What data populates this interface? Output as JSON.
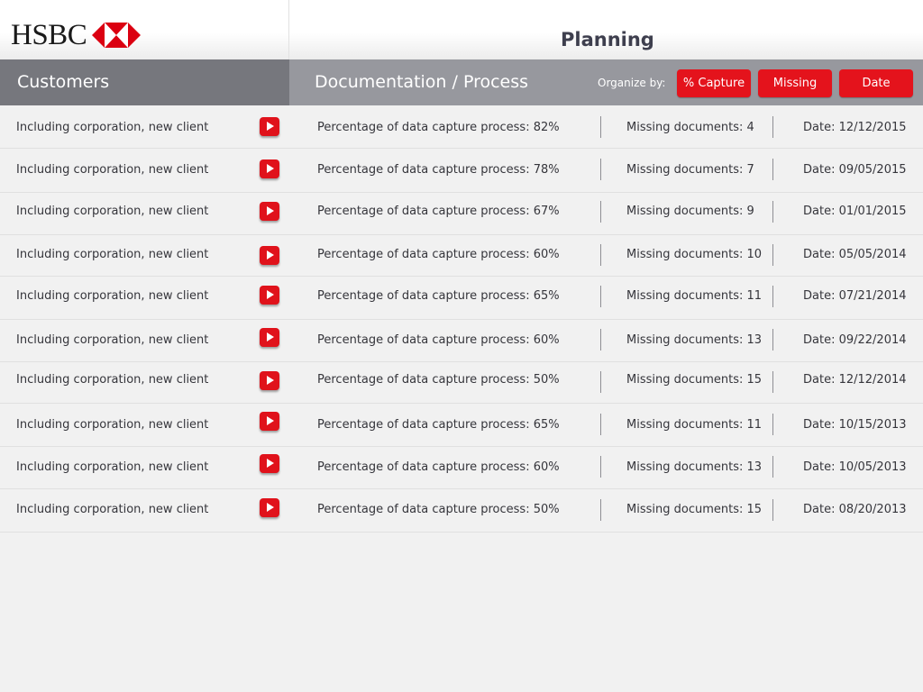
{
  "brand": {
    "name": "HSBC"
  },
  "header": {
    "title": "Planning"
  },
  "columns": {
    "customers": "Customers",
    "documentation": "Documentation / Process"
  },
  "organize": {
    "label": "Organize by:",
    "buttons": [
      "% Capture",
      "Missing",
      "Date"
    ]
  },
  "colors": {
    "accent": "#e4131c",
    "header_dark": "#76777d",
    "header_light": "#97989e"
  },
  "rows": [
    {
      "customer": "Including corporation, new client",
      "percentage": "Percentage of data capture process: 82%",
      "missing": "Missing documents: 4",
      "date": "Date: 12/12/2015"
    },
    {
      "customer": "Including corporation, new client",
      "percentage": "Percentage of data capture process: 78%",
      "missing": "Missing documents: 7",
      "date": "Date: 09/05/2015"
    },
    {
      "customer": "Including corporation, new client",
      "percentage": "Percentage of data capture process: 67%",
      "missing": "Missing documents: 9",
      "date": "Date: 01/01/2015"
    },
    {
      "customer": "Including corporation, new client",
      "percentage": "Percentage of data capture process: 60%",
      "missing": "Missing documents: 10",
      "date": "Date: 05/05/2014"
    },
    {
      "customer": "Including corporation, new client",
      "percentage": "Percentage of data capture process: 65%",
      "missing": "Missing documents: 11",
      "date": "Date: 07/21/2014"
    },
    {
      "customer": "Including corporation, new client",
      "percentage": "Percentage of data capture process: 60%",
      "missing": "Missing documents: 13",
      "date": "Date: 09/22/2014"
    },
    {
      "customer": "Including corporation, new client",
      "percentage": "Percentage of data capture process: 50%",
      "missing": "Missing documents: 15",
      "date": "Date: 12/12/2014"
    },
    {
      "customer": "Including corporation, new client",
      "percentage": "Percentage of data capture process: 65%",
      "missing": "Missing documents: 11",
      "date": "Date: 10/15/2013"
    },
    {
      "customer": "Including corporation, new client",
      "percentage": "Percentage of data capture process: 60%",
      "missing": "Missing documents: 13",
      "date": "Date: 10/05/2013"
    },
    {
      "customer": "Including corporation, new client",
      "percentage": "Percentage of data capture process: 50%",
      "missing": "Missing documents: 15",
      "date": "Date: 08/20/2013"
    }
  ]
}
